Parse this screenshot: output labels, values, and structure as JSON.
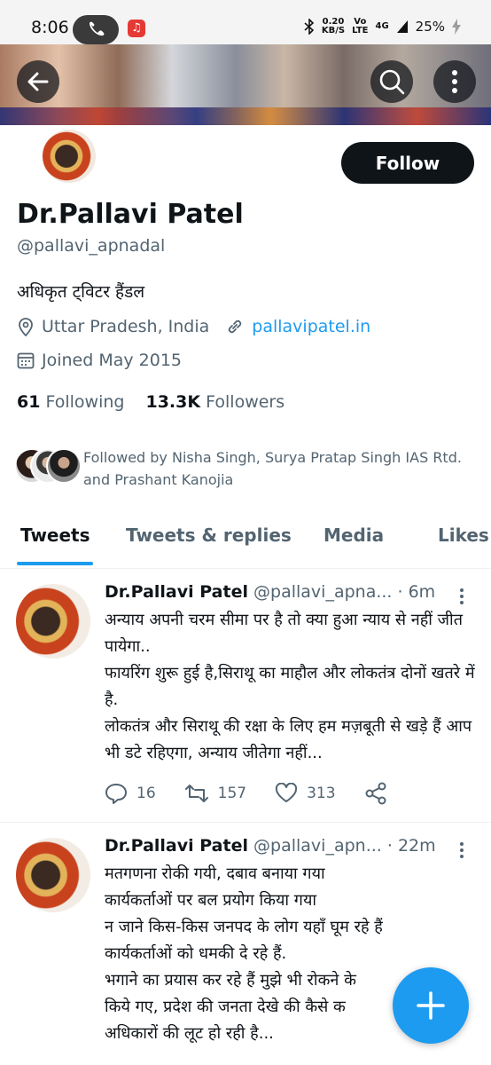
{
  "status_bar": {
    "time": "8:06",
    "speed_value": "0.20",
    "speed_unit": "KB/S",
    "volte_top": "Vo",
    "volte_bottom": "LTE",
    "network": "4G",
    "battery": "25%"
  },
  "profile": {
    "name": "Dr.Pallavi Patel",
    "handle": "@pallavi_apnadal",
    "bio": "अधिकृत ट्विटर हैंडल",
    "location": "Uttar Pradesh, India",
    "website": "pallavipatel.in",
    "joined": "Joined May 2015",
    "following_count": "61",
    "following_label": "Following",
    "followers_count": "13.3K",
    "followers_label": "Followers",
    "followed_by": "Followed by Nisha Singh, Surya Pratap Singh IAS Rtd. and Prashant Kanojia",
    "follow_button": "Follow"
  },
  "tabs": [
    {
      "label": "Tweets",
      "active": true
    },
    {
      "label": "Tweets & replies",
      "active": false
    },
    {
      "label": "Media",
      "active": false
    },
    {
      "label": "Likes",
      "active": false
    }
  ],
  "tweets": [
    {
      "name": "Dr.Pallavi Patel",
      "handle": "@pallavi_apna...",
      "time": "· 6m",
      "text": "अन्याय अपनी चरम सीमा पर है तो क्या हुआ न्याय से नहीं जीत पायेगा..\nफायरिंग शुरू हुई है,सिराथू का माहौल और लोकतंत्र दोनों खतरे में है.\nलोकतंत्र और सिराथू की रक्षा के लिए हम मज़बूती से खड़े हैं आप भी डटे रहिएगा, अन्याय जीतेगा नहीं...",
      "replies": "16",
      "retweets": "157",
      "likes": "313"
    },
    {
      "name": "Dr.Pallavi Patel",
      "handle": "@pallavi_apn...",
      "time": "· 22m",
      "text": "मतगणना रोकी गयी, दबाव बनाया गया\nकार्यकर्ताओं पर बल प्रयोग किया गया\nन जाने किस-किस जनपद के लोग यहाँ घूम रहे हैं\nकार्यकर्ताओं को धमकी दे रहे हैं.\nभगाने का प्रयास कर रहे हैं मुझे भी रोकने के\nकिये गए, प्रदेश की जनता देखे की कैसे क\nअधिकारों की लूट हो रही है..."
    }
  ],
  "icons": {
    "back": "arrow-left-icon",
    "search": "search-icon",
    "more": "more-vertical-icon",
    "compose": "plus-icon"
  },
  "colors": {
    "accent": "#1d9bf0",
    "text": "#0f1419",
    "secondary": "#536471"
  }
}
